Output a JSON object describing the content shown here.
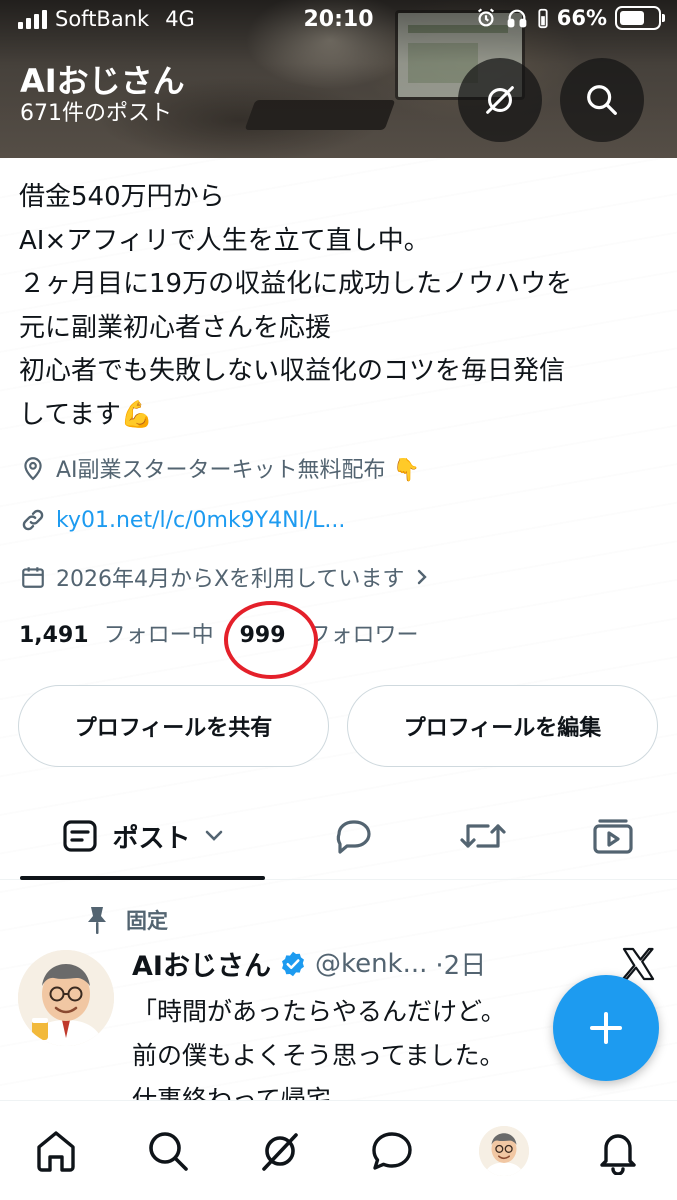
{
  "status_bar": {
    "carrier": "SoftBank",
    "network": "4G",
    "time": "20:10",
    "battery": "66%",
    "battery_level": 0.66
  },
  "header": {
    "name": "AIおじさん",
    "post_count": "671件のポスト",
    "grok_icon": "grok-icon",
    "search_icon": "search-icon"
  },
  "bio": {
    "lines": [
      "借金540万円から",
      "AI×アフィリで人生を立て直し中。",
      "２ヶ月目に19万の収益化に成功したノウハウを",
      "元に副業初心者さんを応援",
      "初心者でも失敗しない収益化のコツを毎日発信",
      "してます💪"
    ]
  },
  "meta": {
    "location": "AI副業スターターキット無料配布 👇",
    "link": "ky01.net/l/c/0mk9Y4Nl/L...",
    "joined": "2026年4月からXを利用しています"
  },
  "stats": {
    "following_count": "1,491",
    "following_label": "フォロー中",
    "followers_count": "999",
    "followers_label": "フォロワー"
  },
  "buttons": {
    "share": "プロフィールを共有",
    "edit": "プロフィールを編集"
  },
  "tabs": {
    "posts": "ポスト"
  },
  "post": {
    "pinned_label": "固定",
    "author": "AIおじさん",
    "handle": "@kenk...",
    "time": "·2日",
    "lines": [
      "「時間があったらやるんだけど。",
      "前の僕もよくそう思ってました。",
      "仕事終わって帰宅。"
    ]
  },
  "colors": {
    "accent": "#1d9bf0",
    "highlight_circle": "#e4202a",
    "text": "#0f1419",
    "secondary_text": "#536471"
  }
}
